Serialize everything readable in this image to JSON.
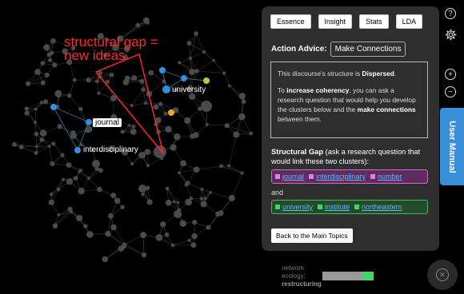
{
  "graph": {
    "annotation_line1": "structural gap =",
    "annotation_line2": "new ideas",
    "labels": {
      "university": "university",
      "journal": "journal",
      "interdisciplinary": "interdisciplinary"
    },
    "colors": {
      "node": "#4a4a4a",
      "edge": "#333333",
      "highlight_blue": "#2f8fe0",
      "highlight_orange": "#f5a623",
      "highlight_green": "#a4d63c",
      "gap_triangle": "#ff2a2a"
    }
  },
  "panel": {
    "tabs": [
      "Essence",
      "Insight",
      "Stats",
      "LDA"
    ],
    "advice_label": "Action Advice:",
    "advice_button": "Make Connections",
    "advice_text": {
      "p1_pre": "This discourse's structure is ",
      "p1_bold": "Dispersed",
      "p1_post": ".",
      "p2_pre": "To ",
      "p2_bold1": "increase coherency",
      "p2_mid": ", you can ask a research question that would help you develop the clusters below and the ",
      "p2_bold2": "make connections",
      "p2_post": " between them."
    },
    "gap_title_bold": "Structural Gap",
    "gap_title_rest": " (ask a research question that would link these two clusters):",
    "cluster1": [
      "journal",
      "interdisciplinary",
      "number"
    ],
    "and_text": "and",
    "cluster2": [
      "university",
      "institute",
      "northeastern"
    ],
    "back_button": "Back to the Main Topics"
  },
  "sidebar": {
    "help_icon": "?",
    "settings_icon": "gear-icon",
    "zoom_in": "+",
    "zoom_out": "−",
    "user_manual": "User Manual"
  },
  "ecology": {
    "line1": "network",
    "line2": "ecology:",
    "line3": "restructuring",
    "level": 0.22
  },
  "close_icon": "close-icon"
}
